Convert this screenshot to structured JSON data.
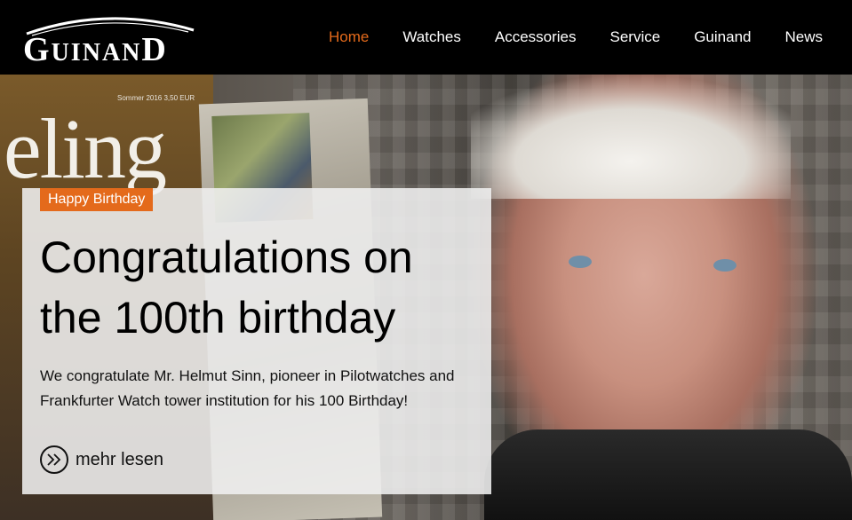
{
  "brand": {
    "logo_text": "GUINAND"
  },
  "nav": {
    "items": [
      {
        "label": "Home",
        "active": true
      },
      {
        "label": "Watches",
        "active": false
      },
      {
        "label": "Accessories",
        "active": false
      },
      {
        "label": "Service",
        "active": false
      },
      {
        "label": "Guinand",
        "active": false
      },
      {
        "label": "News",
        "active": false
      }
    ]
  },
  "hero": {
    "badge": "Happy Birthday",
    "headline": "Congratulations on the 100th birthday",
    "description": "We congratulate Mr. Helmut Sinn, pioneer in Pilotwatches and Frankfurter Watch tower institution for his 100 Birthday!",
    "cta_label": "mehr lesen",
    "magazine_title": "eling",
    "magazine_issue": "Sommer 2016   3,50 EUR"
  },
  "colors": {
    "accent": "#e46a1b",
    "navbar": "#000000"
  },
  "icons": {
    "cta": "double-chevron-right-icon"
  }
}
